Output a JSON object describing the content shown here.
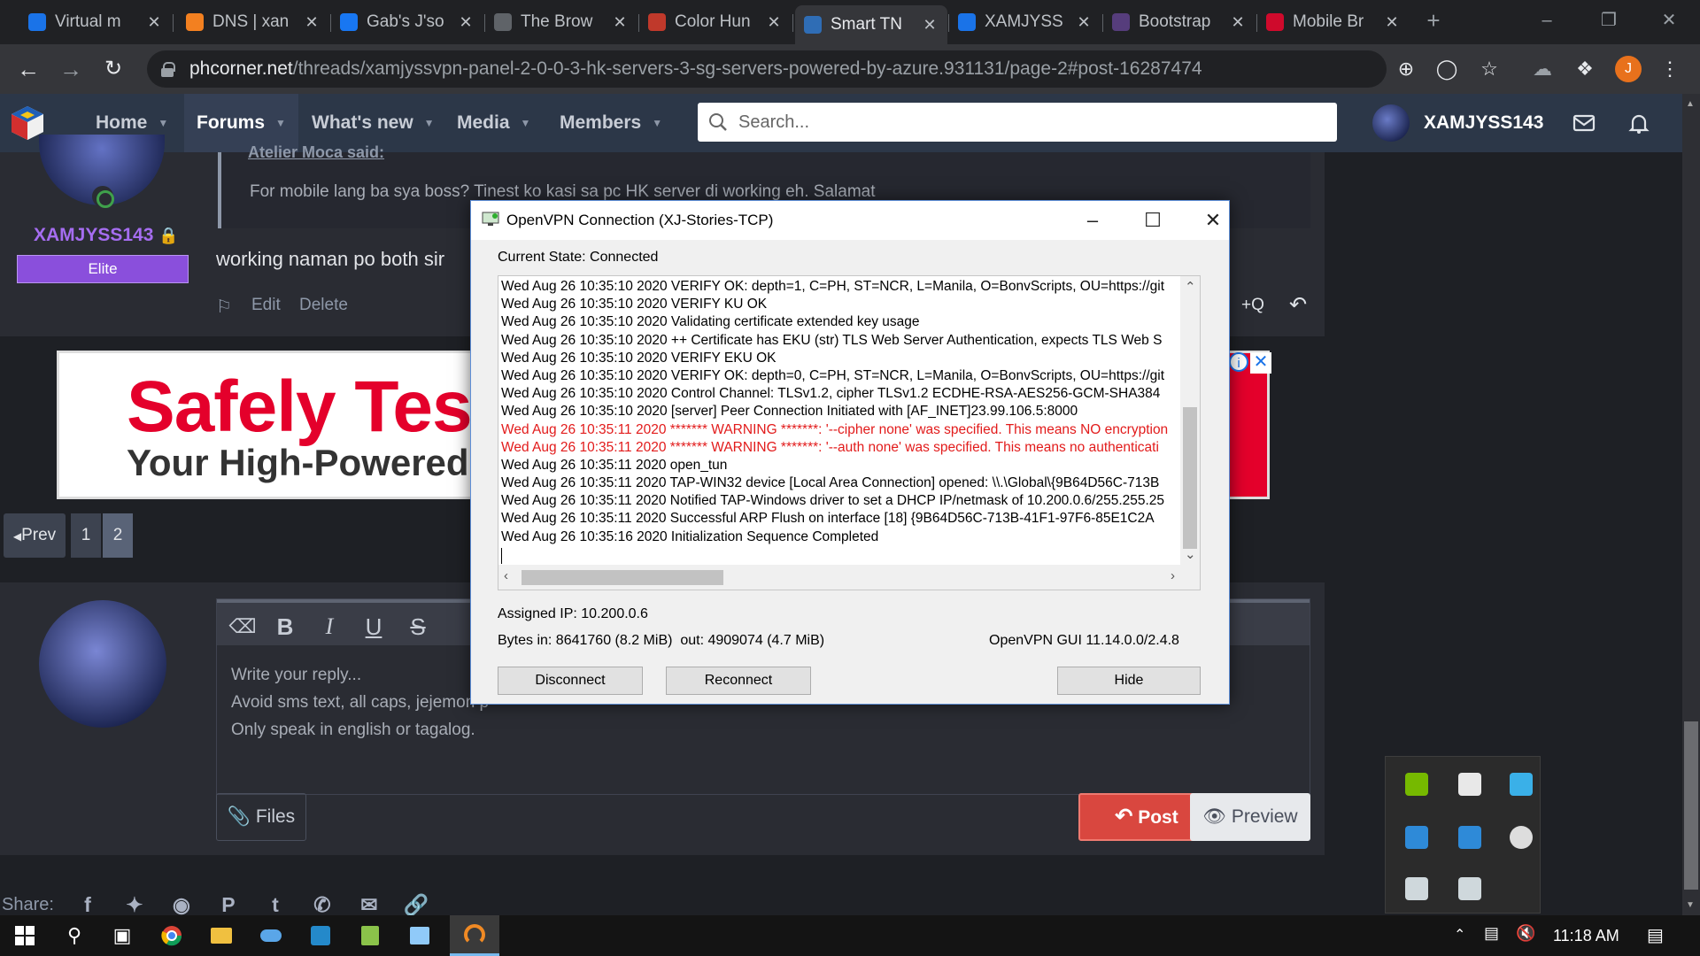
{
  "browser": {
    "tabs": [
      {
        "label": "Virtual m",
        "color": "#1a73e8"
      },
      {
        "label": "DNS | xan",
        "color": "#f38020"
      },
      {
        "label": "Gab's J'so",
        "color": "#1877f2"
      },
      {
        "label": "The Brow",
        "color": "#5f6368"
      },
      {
        "label": "Color Hun",
        "color": "#c0392b"
      },
      {
        "label": "Smart TN",
        "color": "#2f6db5"
      },
      {
        "label": "XAMJYSS",
        "color": "#1a73e8"
      },
      {
        "label": "Bootstrap",
        "color": "#563d7c"
      },
      {
        "label": "Mobile Br",
        "color": "#cf0a2c"
      }
    ],
    "new_tab": "+",
    "url_domain": "phcorner.net",
    "url_path": "/threads/xamjyssvpn-panel-2-0-0-3-hk-servers-3-sg-servers-powered-by-azure.931131/page-2#post-16287474",
    "profile_initial": "J"
  },
  "site": {
    "nav": [
      "Home",
      "Forums",
      "What's new",
      "Media",
      "Members"
    ],
    "search_placeholder": "Search...",
    "username": "XAMJYSS143"
  },
  "post": {
    "quote_author": "Atelier Moca said:",
    "quote_text": "For mobile lang ba sya boss? Tinest ko kasi sa pc HK server di working eh. Salamat",
    "username": "XAMJYSS143",
    "badge": "Elite",
    "text": "working naman po both sir",
    "edit": "Edit",
    "delete": "Delete",
    "multiquote": "+Q"
  },
  "ad": {
    "title": "Safely Test",
    "subtitle": "Your High-Powered Devi"
  },
  "pager": {
    "prev": "Prev",
    "pages": [
      "1",
      "2"
    ]
  },
  "reply": {
    "placeholder_lines": [
      "Write your reply...",
      "Avoid sms text, all caps, jejemon p",
      "Only speak in english or tagalog."
    ],
    "files": "Files",
    "post": "Post",
    "preview": "Preview"
  },
  "share_label": "Share:",
  "vpn": {
    "title": "OpenVPN Connection (XJ-Stories-TCP)",
    "state": "Current State: Connected",
    "log": [
      {
        "text": "Wed Aug 26 10:35:10 2020 VERIFY OK: depth=1, C=PH, ST=NCR, L=Manila, O=BonvScripts, OU=https://git",
        "warn": false
      },
      {
        "text": "Wed Aug 26 10:35:10 2020 VERIFY KU OK",
        "warn": false
      },
      {
        "text": "Wed Aug 26 10:35:10 2020 Validating certificate extended key usage",
        "warn": false
      },
      {
        "text": "Wed Aug 26 10:35:10 2020 ++ Certificate has EKU (str) TLS Web Server Authentication, expects TLS Web S",
        "warn": false
      },
      {
        "text": "Wed Aug 26 10:35:10 2020 VERIFY EKU OK",
        "warn": false
      },
      {
        "text": "Wed Aug 26 10:35:10 2020 VERIFY OK: depth=0, C=PH, ST=NCR, L=Manila, O=BonvScripts, OU=https://git",
        "warn": false
      },
      {
        "text": "Wed Aug 26 10:35:10 2020 Control Channel: TLSv1.2, cipher TLSv1.2 ECDHE-RSA-AES256-GCM-SHA384",
        "warn": false
      },
      {
        "text": "Wed Aug 26 10:35:10 2020 [server] Peer Connection Initiated with [AF_INET]23.99.106.5:8000",
        "warn": false
      },
      {
        "text": "Wed Aug 26 10:35:11 2020 ******* WARNING *******: '--cipher none' was specified. This means NO encryption",
        "warn": true
      },
      {
        "text": "Wed Aug 26 10:35:11 2020 ******* WARNING *******: '--auth none' was specified. This means no authenticati",
        "warn": true
      },
      {
        "text": "Wed Aug 26 10:35:11 2020 open_tun",
        "warn": false
      },
      {
        "text": "Wed Aug 26 10:35:11 2020 TAP-WIN32 device [Local Area Connection] opened: \\\\.\\Global\\{9B64D56C-713B",
        "warn": false
      },
      {
        "text": "Wed Aug 26 10:35:11 2020 Notified TAP-Windows driver to set a DHCP IP/netmask of 10.200.0.6/255.255.25",
        "warn": false
      },
      {
        "text": "Wed Aug 26 10:35:11 2020 Successful ARP Flush on interface [18] {9B64D56C-713B-41F1-97F6-85E1C2A",
        "warn": false
      },
      {
        "text": "Wed Aug 26 10:35:16 2020 Initialization Sequence Completed",
        "warn": false
      }
    ],
    "assigned_ip": "Assigned IP: 10.200.0.6",
    "bytes": "Bytes in: 8641760 (8.2 MiB)  out: 4909074 (4.7 MiB)",
    "gui_version": "OpenVPN GUI 11.14.0.0/2.4.8",
    "buttons": {
      "disconnect": "Disconnect",
      "reconnect": "Reconnect",
      "hide": "Hide"
    }
  },
  "taskbar": {
    "clock": "11:18 AM"
  },
  "colors": {
    "site_nav": "#2c3748",
    "accent_purple": "#a56df0",
    "post_button": "#d9473f",
    "warning_text": "#e21b1b"
  }
}
